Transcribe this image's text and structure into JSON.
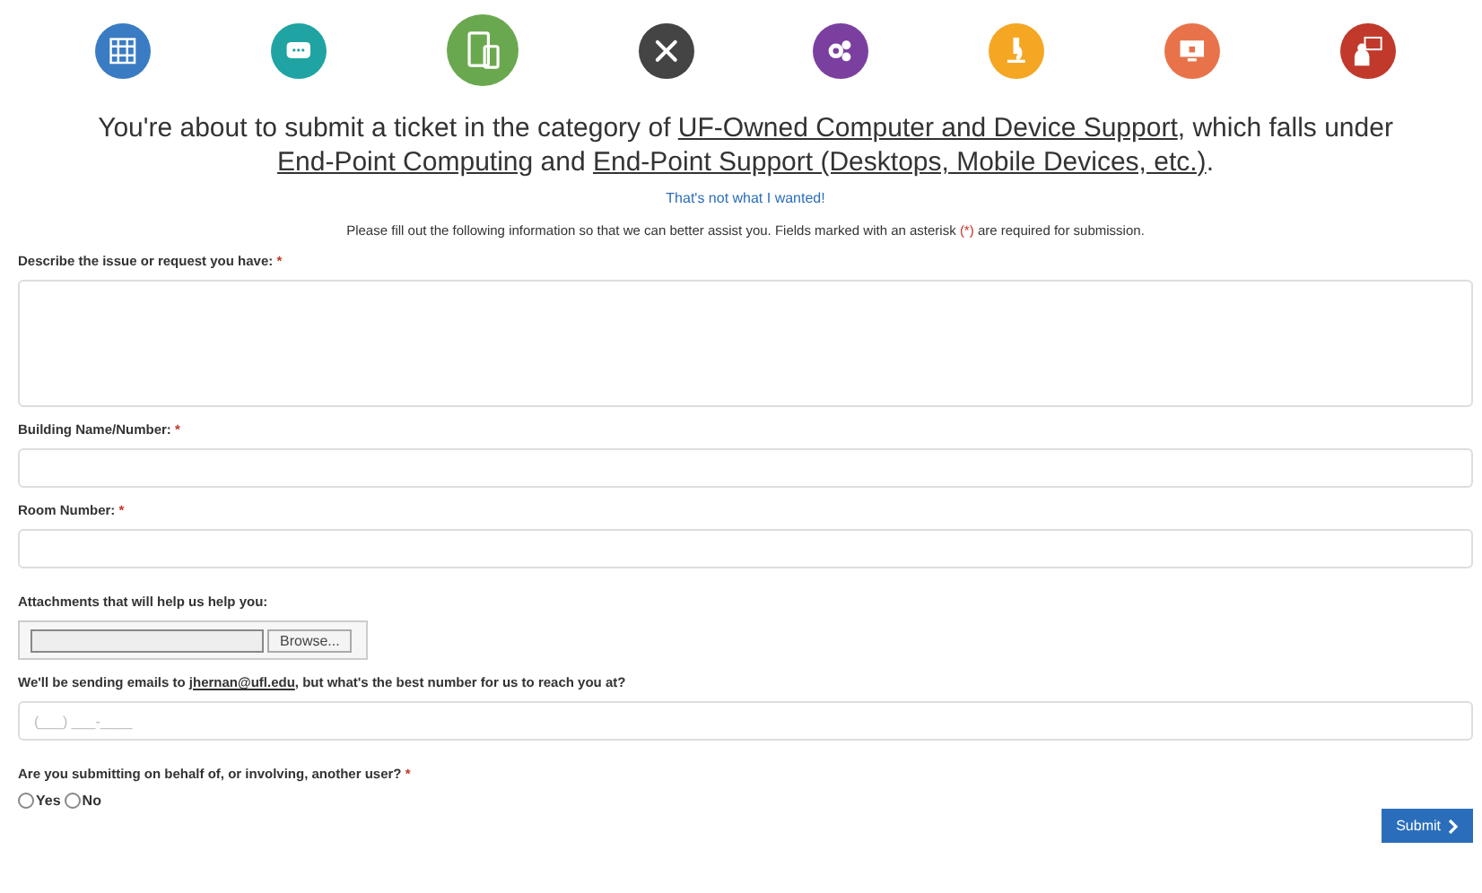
{
  "categories": [
    {
      "color": "#3a7cc4",
      "selected": false
    },
    {
      "color": "#1fa3a3",
      "selected": false
    },
    {
      "color": "#6aa84f",
      "selected": true
    },
    {
      "color": "#444444",
      "selected": false
    },
    {
      "color": "#7b3fa0",
      "selected": false
    },
    {
      "color": "#f5a623",
      "selected": false
    },
    {
      "color": "#e8734a",
      "selected": false
    },
    {
      "color": "#c0392b",
      "selected": false
    }
  ],
  "intro": [
    {
      "kind": "text",
      "text": "You're about to submit a ticket in the category of "
    },
    {
      "kind": "link",
      "text": "UF-Owned Computer and Device Support"
    },
    {
      "kind": "text",
      "text": ", which falls under "
    },
    {
      "kind": "link",
      "text": "End-Point Computing"
    },
    {
      "kind": "text",
      "text": " and "
    },
    {
      "kind": "link",
      "text": "End-Point Support (Desktops, Mobile Devices, etc.)"
    },
    {
      "kind": "text",
      "text": "."
    }
  ],
  "back_link": "That's not what I wanted!",
  "instructions": [
    {
      "kind": "text",
      "text": "Please fill out the following information so that we can better assist you. Fields marked with an asterisk "
    },
    {
      "kind": "mark",
      "text": "(*)"
    },
    {
      "kind": "text",
      "text": " are required for submission."
    }
  ],
  "fields": [
    {
      "kind": "textarea",
      "label": [
        {
          "kind": "text",
          "text": "Describe the issue or request you have: "
        },
        {
          "kind": "mark",
          "text": "*"
        }
      ]
    },
    {
      "kind": "text",
      "label": [
        {
          "kind": "text",
          "text": "Building Name/Number: "
        },
        {
          "kind": "mark",
          "text": "*"
        }
      ]
    },
    {
      "kind": "text",
      "label": [
        {
          "kind": "text",
          "text": "Room Number: "
        },
        {
          "kind": "mark",
          "text": "*"
        }
      ]
    },
    {
      "kind": "file",
      "label": [
        {
          "kind": "text",
          "text": "Attachments that will help us help you:"
        }
      ],
      "button": "Browse..."
    },
    {
      "kind": "phone",
      "label": [
        {
          "kind": "text",
          "text": "We'll be sending emails to "
        },
        {
          "kind": "link",
          "text": "jhernan@ufl.edu"
        },
        {
          "kind": "text",
          "text": ", but what's the best number for us to reach you at?"
        }
      ],
      "placeholder": "(___) ___-____"
    },
    {
      "kind": "radio",
      "label": [
        {
          "kind": "text",
          "text": "Are you submitting on behalf of, or involving, another user? "
        },
        {
          "kind": "mark",
          "text": "*"
        }
      ],
      "options": [
        {
          "label": "Yes",
          "selected": false
        },
        {
          "label": "No",
          "selected": false
        }
      ]
    }
  ],
  "submit": "Submit"
}
